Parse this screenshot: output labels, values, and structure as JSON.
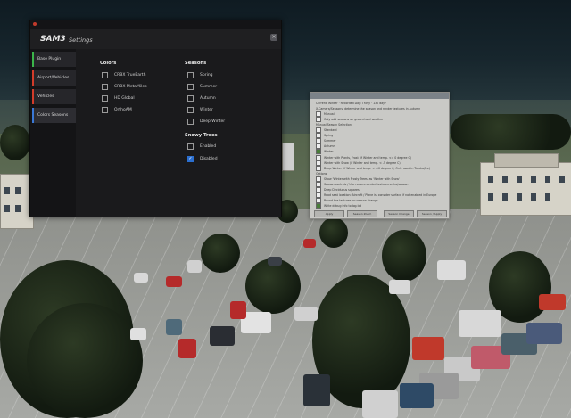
{
  "window": {
    "brand": "SAM3",
    "title": "Settings",
    "close_label": "×"
  },
  "sidebar": {
    "items": [
      {
        "label": "Base Plugin",
        "color": "#3bb54a"
      },
      {
        "label": "Airport/Vehicles",
        "color": "#d23c2a"
      },
      {
        "label": "Vehicles",
        "color": "#d23c2a"
      },
      {
        "label": "Colors Seasons",
        "color": "#3a78d6",
        "active": true
      }
    ]
  },
  "colors": {
    "heading": "Colors",
    "options": [
      {
        "label": "CRBX TrueEarth",
        "checked": false
      },
      {
        "label": "CRBX MetaMiles",
        "checked": false
      },
      {
        "label": "HD Global",
        "checked": false
      },
      {
        "label": "OrthoAM",
        "checked": false
      }
    ]
  },
  "seasons": {
    "heading": "Seasons",
    "options": [
      {
        "label": "Spring",
        "checked": false
      },
      {
        "label": "Summer",
        "checked": false
      },
      {
        "label": "Autumn",
        "checked": false
      },
      {
        "label": "Winter",
        "checked": false
      },
      {
        "label": "Deep Winter",
        "checked": false
      }
    ]
  },
  "snowy_trees": {
    "heading": "Snowy Trees",
    "options": [
      {
        "label": "Enabled",
        "checked": false
      },
      {
        "label": "Disabled",
        "checked": true
      }
    ]
  },
  "dialog": {
    "title": "",
    "lines": [
      {
        "text": "Current: Winter · Recorded Day: Thirty · 130 day?",
        "cb": "none"
      },
      {
        "text": "X-Camera/Seasons: determine the season and render textures in Autumn",
        "cb": "none"
      },
      {
        "text": "Manual",
        "cb": "off"
      },
      {
        "text": "Only add seasons on ground and weather",
        "cb": "off"
      },
      {
        "text": "Manual Season Selection:",
        "cb": "none"
      },
      {
        "text": "Standard",
        "cb": "off"
      },
      {
        "text": "Spring",
        "cb": "off"
      },
      {
        "text": "Summer",
        "cb": "off"
      },
      {
        "text": "Autumn",
        "cb": "off"
      },
      {
        "text": "Winter",
        "cb": "on"
      },
      {
        "text": "Winter with Plants, Frost (if Winter and temp. <= 0 degree C)",
        "cb": "off"
      },
      {
        "text": "Winter with Snow (if Winter and temp. < -5 degree C)",
        "cb": "off"
      },
      {
        "text": "Deep Winter (if Winter and temp. < -10 degree C, Only used in Tundra/Ice)",
        "cb": "off"
      },
      {
        "text": "Options:",
        "cb": "none"
      },
      {
        "text": "Show 'Winter with Frosty Trees' as 'Winter with Snow'",
        "cb": "off"
      },
      {
        "text": "Season controls / Use recommended textures ortho/season",
        "cb": "off"
      },
      {
        "text": "Deep Deciduous squares",
        "cb": "off"
      },
      {
        "text": "Read seat location: Aircraft / Plane is: consider surface if not enabled in Europe",
        "cb": "off"
      },
      {
        "text": "Round the textures on season change",
        "cb": "off"
      },
      {
        "text": "Write debug info to log.txt",
        "cb": "on"
      }
    ],
    "buttons": [
      "Apply",
      "Season Zoom",
      "Season Change",
      "Season / Apply"
    ]
  }
}
